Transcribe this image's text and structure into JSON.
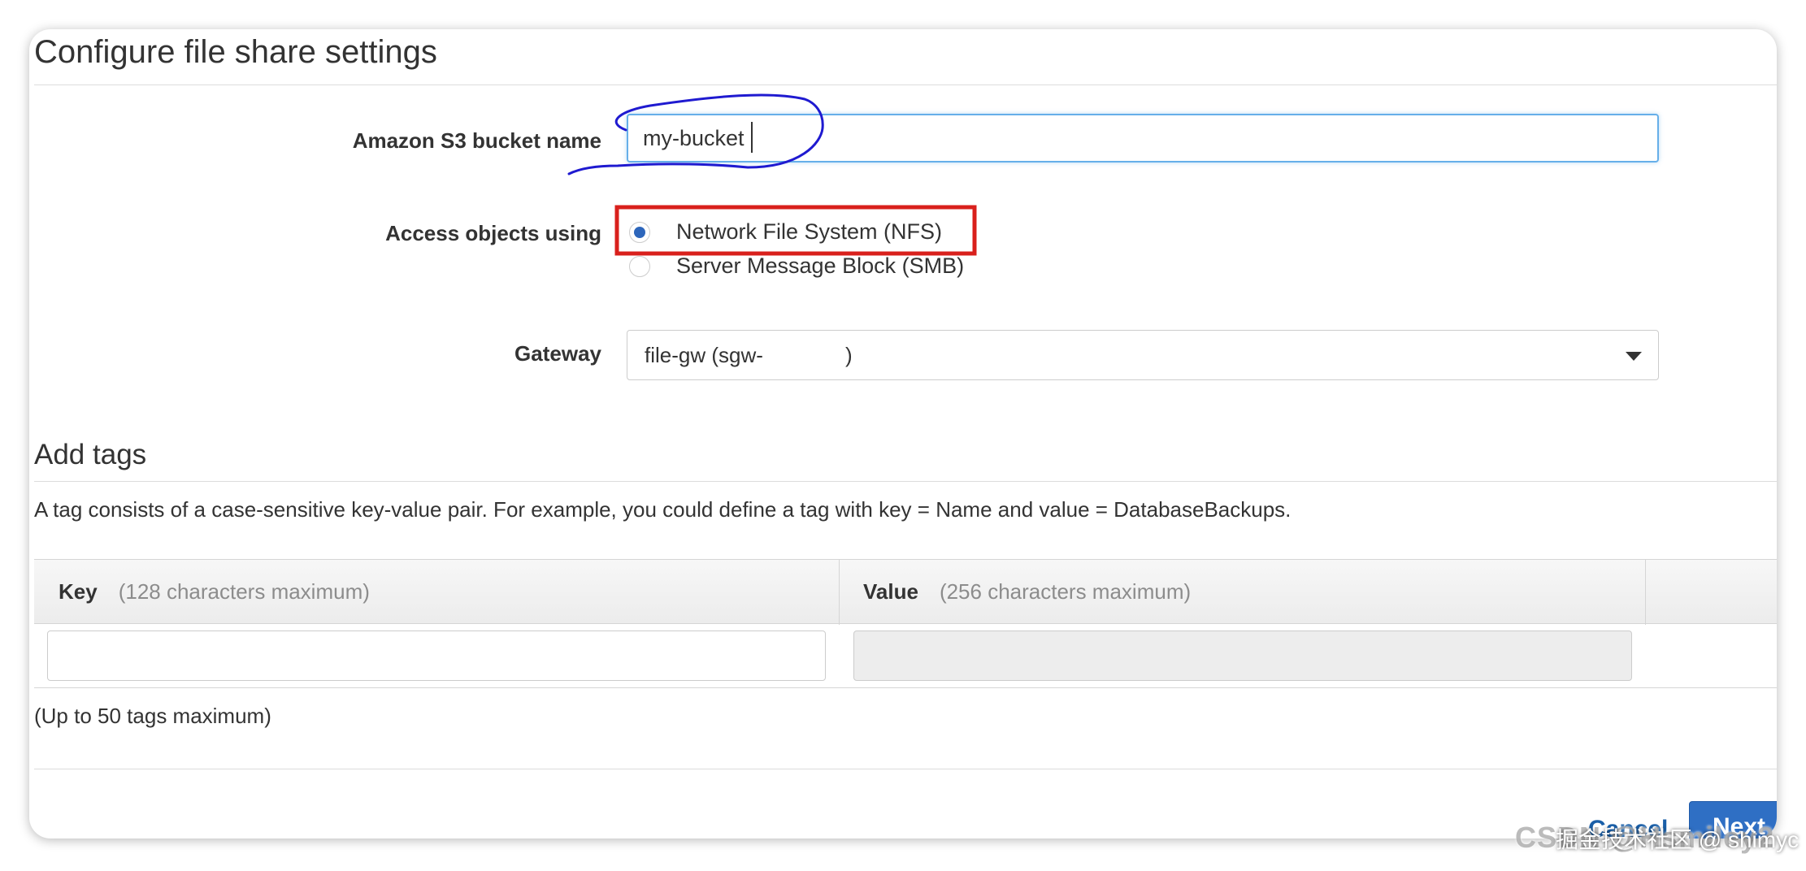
{
  "page": {
    "title": "Configure file share settings"
  },
  "form": {
    "bucket": {
      "label": "Amazon S3 bucket name",
      "value": "my-bucket"
    },
    "access": {
      "label": "Access objects using",
      "options": [
        {
          "label": "Network File System (NFS)",
          "selected": true
        },
        {
          "label": "Server Message Block (SMB)",
          "selected": false
        }
      ]
    },
    "gateway": {
      "label": "Gateway",
      "value": "file-gw (sgw-              )"
    }
  },
  "tags": {
    "title": "Add tags",
    "description": "A tag consists of a case-sensitive key-value pair. For example, you could define a tag with key = Name and value = DatabaseBackups.",
    "columns": {
      "key": {
        "label": "Key",
        "hint": "(128 characters maximum)"
      },
      "value": {
        "label": "Value",
        "hint": "(256 characters maximum)"
      }
    },
    "limit_note": "(Up to 50 tags maximum)"
  },
  "footer": {
    "cancel_label": "Cancel",
    "next_label": "Next"
  },
  "watermark": {
    "latin": "CSDN @Hsmiley2",
    "chinese": "掘金技术社区 @ shimyc"
  },
  "colors": {
    "accent_blue": "#2f6fc4",
    "focus_border": "#66afe9",
    "radio_selected": "#2d66bb",
    "annotation_red": "#d9201c",
    "annotation_blue": "#1f1ad0"
  }
}
